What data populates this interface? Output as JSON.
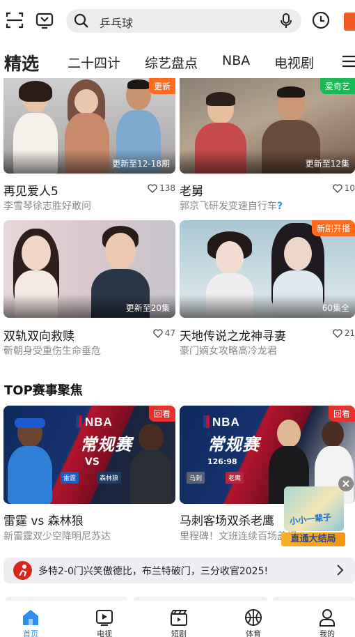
{
  "search": {
    "query": "乒乓球"
  },
  "tabs": [
    "精选",
    "二十四计",
    "综艺盘点",
    "NBA",
    "电视剧"
  ],
  "cards": [
    {
      "title": "再见爱人5",
      "subtitle": "李雪琴徐志胜好敢问",
      "episodes": "更新至12-18期",
      "badge": "更新",
      "likes": "138"
    },
    {
      "title": "老舅",
      "subtitle": "郭京飞研发变速自行车",
      "episodes": "更新至12集",
      "badge": "爱奇艺",
      "likes": "10"
    },
    {
      "title": "双轨双向救赎",
      "subtitle": "靳朝身受重伤生命垂危",
      "episodes": "更新至20集",
      "badge": "",
      "likes": "47"
    },
    {
      "title": "天地传说之龙神寻妻",
      "subtitle": "豪门嫡女攻略高冷龙君",
      "episodes": "60集全",
      "badge": "新剧开播",
      "likes": "21"
    }
  ],
  "section_title": "TOP赛事聚焦",
  "games": [
    {
      "title": "雷霆 vs 森林狼",
      "subtitle": "新雷霆双少空降明尼苏达",
      "badge": "回看",
      "logo": "NBA",
      "stage": "常规赛",
      "vs": "VS",
      "team_a": "雷霆",
      "team_b": "森林狼"
    },
    {
      "title": "马刺客场双杀老鹰",
      "subtitle": "里程碑！文班连续百场盖帽",
      "badge": "回看",
      "logo": "NBA",
      "stage": "常规赛",
      "score": "126:98",
      "team_a": "马刺",
      "team_b": "老鹰"
    }
  ],
  "news": {
    "text": "多特2-0门兴笑傲德比，布兰特破门，三分收官2025!"
  },
  "promo": {
    "text": "直通大结局",
    "overlay": "小小一辈子"
  },
  "nav": [
    "首页",
    "电视",
    "短剧",
    "体育",
    "我的"
  ],
  "colors": {
    "accent": "#2f8ff0",
    "badge_orange": "#ff6a1f",
    "badge_green": "#19b955",
    "badge_red": "#e8312d"
  }
}
